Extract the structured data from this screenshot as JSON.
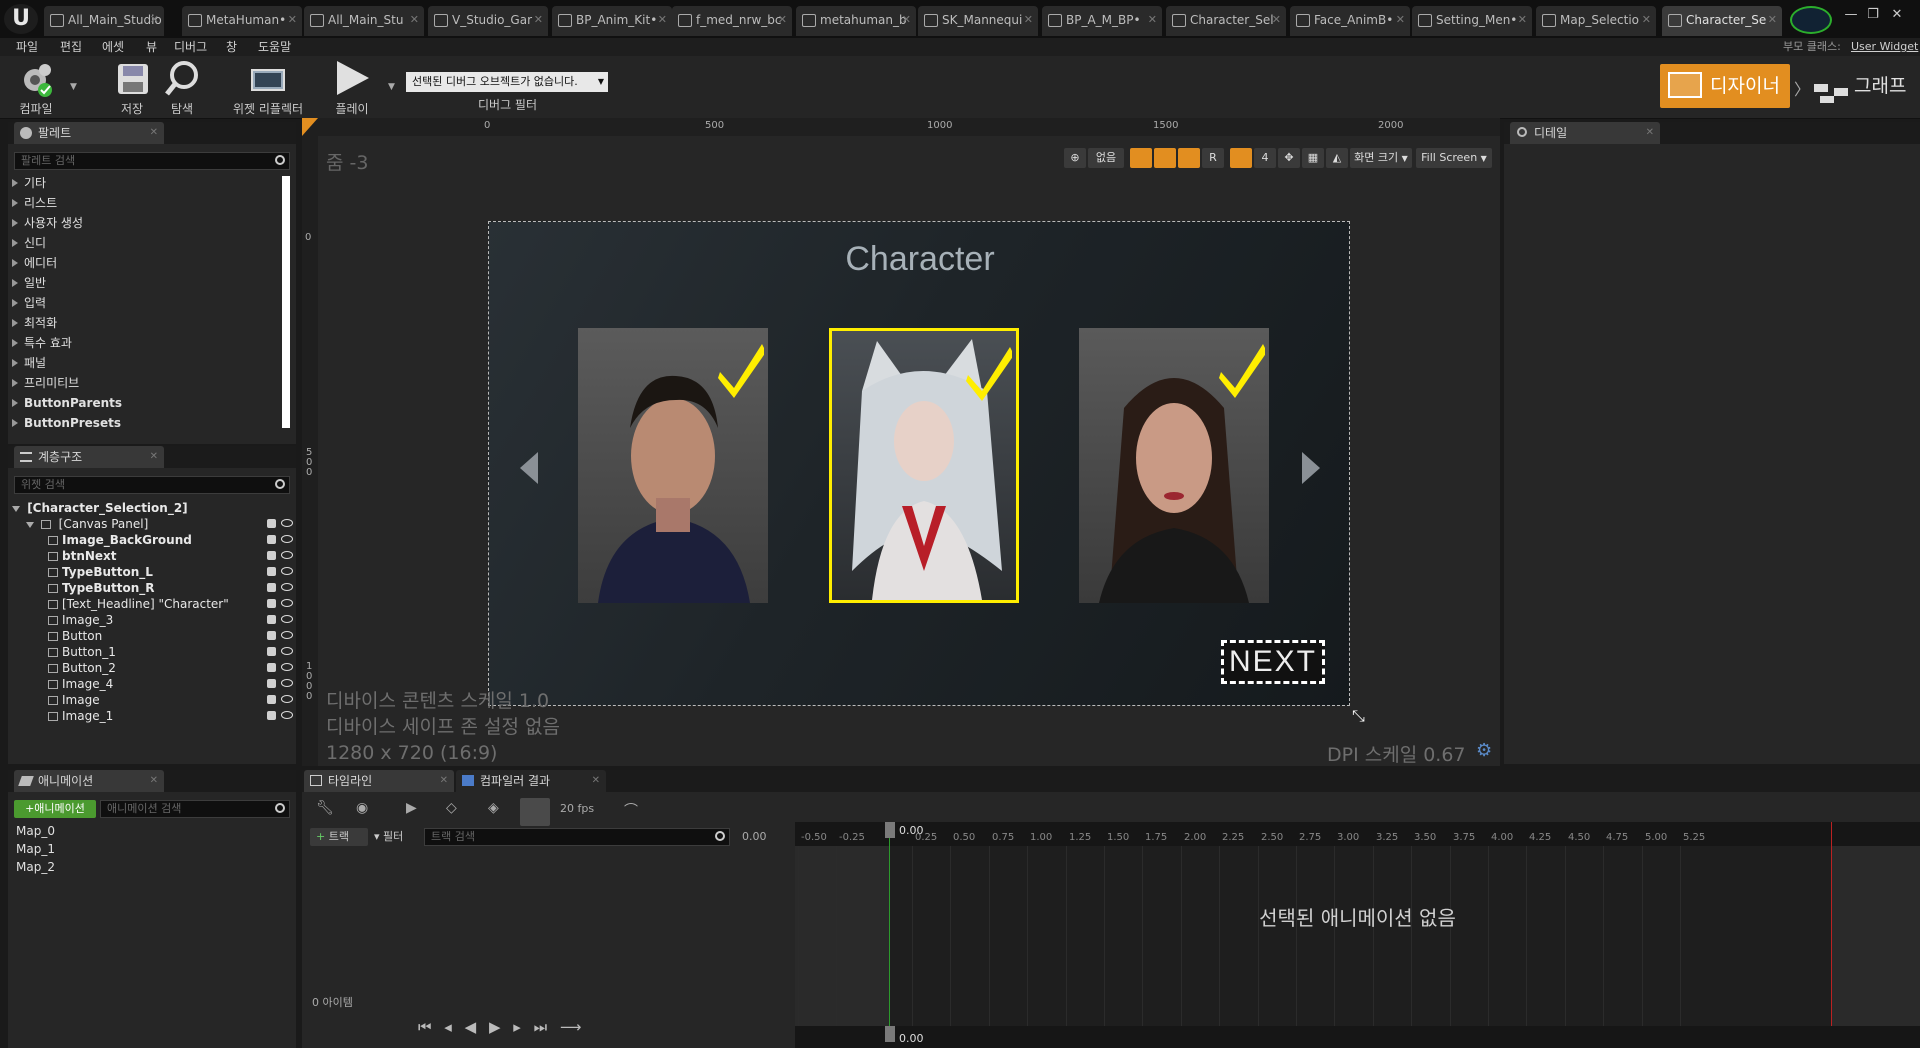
{
  "tabs": [
    {
      "label": "All_Main_Studio"
    },
    {
      "label": "MetaHuman•"
    },
    {
      "label": "All_Main_Stu"
    },
    {
      "label": "V_Studio_Gar"
    },
    {
      "label": "BP_Anim_Kit•"
    },
    {
      "label": "f_med_nrw_bc"
    },
    {
      "label": "metahuman_b"
    },
    {
      "label": "SK_Mannequi"
    },
    {
      "label": "BP_A_M_BP•"
    },
    {
      "label": "Character_Sel"
    },
    {
      "label": "Face_AnimB•"
    },
    {
      "label": "Setting_Men•"
    },
    {
      "label": "Map_Selectio"
    },
    {
      "label": "Character_Se"
    }
  ],
  "window": {
    "minimize": "—",
    "maximize": "❐",
    "close": "✕"
  },
  "menu": [
    "파일",
    "편집",
    "에셋",
    "뷰",
    "디버그",
    "창",
    "도움말"
  ],
  "parent_class": {
    "label": "부모 클래스:",
    "value": "User Widget"
  },
  "toolbar": {
    "compile": "컴파일",
    "save": "저장",
    "browse": "탐색",
    "widget_reflector": "위젯 리플렉터",
    "play": "플레이",
    "debug_dropdown": "선택된 디버그 오브젝트가 없습니다.",
    "debug_filter": "디버그 필터",
    "designer": "디자이너",
    "graph": "그래프"
  },
  "palette": {
    "tab": "팔레트",
    "search_placeholder": "팔레트 검색",
    "items": [
      "기타",
      "리스트",
      "사용자 생성",
      "신디",
      "에디터",
      "일반",
      "입력",
      "최적화",
      "특수 효과",
      "패널",
      "프리미티브",
      "ButtonParents",
      "ButtonPresets"
    ]
  },
  "hierarchy": {
    "tab": "계층구조",
    "search_placeholder": "위젯 검색",
    "root": "[Character_Selection_2]",
    "canvas": "[Canvas Panel]",
    "items": [
      "Image_BackGround",
      "btnNext",
      "TypeButton_L",
      "TypeButton_R",
      "[Text_Headline] \"Character\"",
      "Image_3",
      "Button",
      "Button_1",
      "Button_2",
      "Image_4",
      "Image",
      "Image_1"
    ]
  },
  "details": {
    "tab": "디테일"
  },
  "designer": {
    "zoom": "줌 -3",
    "ruler_top": [
      "0",
      "500",
      "1000",
      "1500",
      "2000"
    ],
    "ruler_left": [
      "0",
      "5 0 0",
      "1 0 0 0"
    ],
    "toolbar": {
      "none": "없음",
      "r": "R",
      "four": "4",
      "screen_size": "화면 크기",
      "fill_screen": "Fill Screen"
    },
    "dpi_scale_info": "디바이스 콘텐츠 스케일 1.0",
    "safe_zone_info": "디바이스 세이프 존 설정 없음",
    "resolution": "1280 x 720 (16:9)",
    "dpi": "DPI 스케일 0.67"
  },
  "widget": {
    "headline": "Character",
    "next": "NEXT"
  },
  "animation": {
    "tab": "애니메이션",
    "add_button": "+애니메이션",
    "search_placeholder": "애니메이션 검색",
    "items": [
      "Map_0",
      "Map_1",
      "Map_2"
    ]
  },
  "timeline": {
    "tab": "타임라인",
    "tab2": "컴파일러 결과",
    "fps": "20 fps",
    "track": "트랙",
    "filter": "필터",
    "search_placeholder": "트랙 검색",
    "time": "0.00",
    "playhead": "0.00",
    "no_animation": "선택된 애니메이션 없음",
    "item_count": "0 아이템",
    "ticks": [
      "-0.50",
      "-0.25",
      "0.25",
      "0.50",
      "0.75",
      "1.00",
      "1.25",
      "1.50",
      "1.75",
      "2.00",
      "2.25",
      "2.50",
      "2.75",
      "3.00",
      "3.25",
      "3.50",
      "3.75",
      "4.00",
      "4.25",
      "4.50",
      "4.75",
      "5.00",
      "5.25"
    ]
  },
  "colors": {
    "accent_orange": "#e28e20",
    "highlight_yellow": "#ffee00",
    "add_green": "#4b9a2f"
  }
}
